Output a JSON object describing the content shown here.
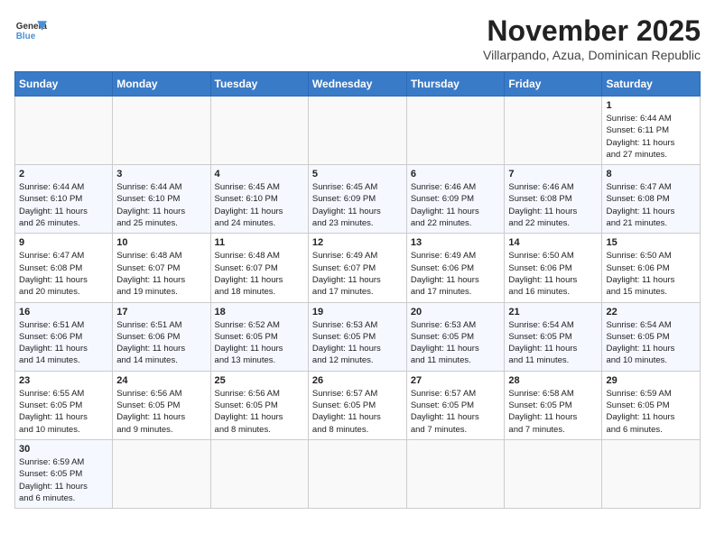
{
  "header": {
    "logo_general": "General",
    "logo_blue": "Blue",
    "title": "November 2025",
    "subtitle": "Villarpando, Azua, Dominican Republic"
  },
  "columns": [
    "Sunday",
    "Monday",
    "Tuesday",
    "Wednesday",
    "Thursday",
    "Friday",
    "Saturday"
  ],
  "weeks": [
    {
      "days": [
        {
          "num": "",
          "empty": true
        },
        {
          "num": "",
          "empty": true
        },
        {
          "num": "",
          "empty": true
        },
        {
          "num": "",
          "empty": true
        },
        {
          "num": "",
          "empty": true
        },
        {
          "num": "",
          "empty": true
        },
        {
          "num": "1",
          "info": "Sunrise: 6:44 AM\nSunset: 6:11 PM\nDaylight: 11 hours\nand 27 minutes."
        }
      ]
    },
    {
      "days": [
        {
          "num": "2",
          "info": "Sunrise: 6:44 AM\nSunset: 6:10 PM\nDaylight: 11 hours\nand 26 minutes."
        },
        {
          "num": "3",
          "info": "Sunrise: 6:44 AM\nSunset: 6:10 PM\nDaylight: 11 hours\nand 25 minutes."
        },
        {
          "num": "4",
          "info": "Sunrise: 6:45 AM\nSunset: 6:10 PM\nDaylight: 11 hours\nand 24 minutes."
        },
        {
          "num": "5",
          "info": "Sunrise: 6:45 AM\nSunset: 6:09 PM\nDaylight: 11 hours\nand 23 minutes."
        },
        {
          "num": "6",
          "info": "Sunrise: 6:46 AM\nSunset: 6:09 PM\nDaylight: 11 hours\nand 22 minutes."
        },
        {
          "num": "7",
          "info": "Sunrise: 6:46 AM\nSunset: 6:08 PM\nDaylight: 11 hours\nand 22 minutes."
        },
        {
          "num": "8",
          "info": "Sunrise: 6:47 AM\nSunset: 6:08 PM\nDaylight: 11 hours\nand 21 minutes."
        }
      ]
    },
    {
      "days": [
        {
          "num": "9",
          "info": "Sunrise: 6:47 AM\nSunset: 6:08 PM\nDaylight: 11 hours\nand 20 minutes."
        },
        {
          "num": "10",
          "info": "Sunrise: 6:48 AM\nSunset: 6:07 PM\nDaylight: 11 hours\nand 19 minutes."
        },
        {
          "num": "11",
          "info": "Sunrise: 6:48 AM\nSunset: 6:07 PM\nDaylight: 11 hours\nand 18 minutes."
        },
        {
          "num": "12",
          "info": "Sunrise: 6:49 AM\nSunset: 6:07 PM\nDaylight: 11 hours\nand 17 minutes."
        },
        {
          "num": "13",
          "info": "Sunrise: 6:49 AM\nSunset: 6:06 PM\nDaylight: 11 hours\nand 17 minutes."
        },
        {
          "num": "14",
          "info": "Sunrise: 6:50 AM\nSunset: 6:06 PM\nDaylight: 11 hours\nand 16 minutes."
        },
        {
          "num": "15",
          "info": "Sunrise: 6:50 AM\nSunset: 6:06 PM\nDaylight: 11 hours\nand 15 minutes."
        }
      ]
    },
    {
      "days": [
        {
          "num": "16",
          "info": "Sunrise: 6:51 AM\nSunset: 6:06 PM\nDaylight: 11 hours\nand 14 minutes."
        },
        {
          "num": "17",
          "info": "Sunrise: 6:51 AM\nSunset: 6:06 PM\nDaylight: 11 hours\nand 14 minutes."
        },
        {
          "num": "18",
          "info": "Sunrise: 6:52 AM\nSunset: 6:05 PM\nDaylight: 11 hours\nand 13 minutes."
        },
        {
          "num": "19",
          "info": "Sunrise: 6:53 AM\nSunset: 6:05 PM\nDaylight: 11 hours\nand 12 minutes."
        },
        {
          "num": "20",
          "info": "Sunrise: 6:53 AM\nSunset: 6:05 PM\nDaylight: 11 hours\nand 11 minutes."
        },
        {
          "num": "21",
          "info": "Sunrise: 6:54 AM\nSunset: 6:05 PM\nDaylight: 11 hours\nand 11 minutes."
        },
        {
          "num": "22",
          "info": "Sunrise: 6:54 AM\nSunset: 6:05 PM\nDaylight: 11 hours\nand 10 minutes."
        }
      ]
    },
    {
      "days": [
        {
          "num": "23",
          "info": "Sunrise: 6:55 AM\nSunset: 6:05 PM\nDaylight: 11 hours\nand 10 minutes."
        },
        {
          "num": "24",
          "info": "Sunrise: 6:56 AM\nSunset: 6:05 PM\nDaylight: 11 hours\nand 9 minutes."
        },
        {
          "num": "25",
          "info": "Sunrise: 6:56 AM\nSunset: 6:05 PM\nDaylight: 11 hours\nand 8 minutes."
        },
        {
          "num": "26",
          "info": "Sunrise: 6:57 AM\nSunset: 6:05 PM\nDaylight: 11 hours\nand 8 minutes."
        },
        {
          "num": "27",
          "info": "Sunrise: 6:57 AM\nSunset: 6:05 PM\nDaylight: 11 hours\nand 7 minutes."
        },
        {
          "num": "28",
          "info": "Sunrise: 6:58 AM\nSunset: 6:05 PM\nDaylight: 11 hours\nand 7 minutes."
        },
        {
          "num": "29",
          "info": "Sunrise: 6:59 AM\nSunset: 6:05 PM\nDaylight: 11 hours\nand 6 minutes."
        }
      ]
    },
    {
      "days": [
        {
          "num": "30",
          "info": "Sunrise: 6:59 AM\nSunset: 6:05 PM\nDaylight: 11 hours\nand 6 minutes."
        },
        {
          "num": "",
          "empty": true
        },
        {
          "num": "",
          "empty": true
        },
        {
          "num": "",
          "empty": true
        },
        {
          "num": "",
          "empty": true
        },
        {
          "num": "",
          "empty": true
        },
        {
          "num": "",
          "empty": true
        }
      ]
    }
  ]
}
